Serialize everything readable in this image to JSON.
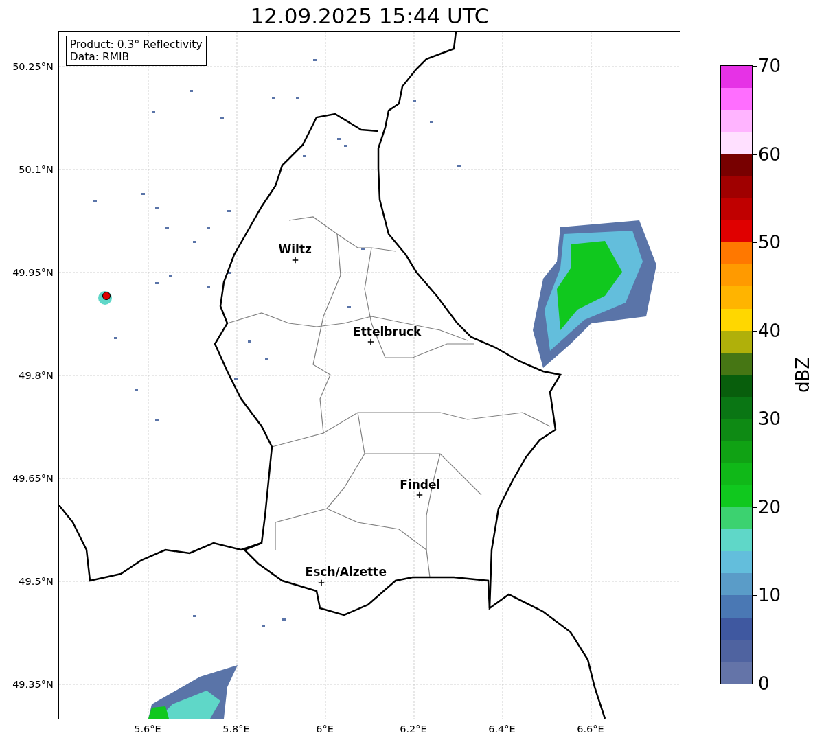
{
  "title": "12.09.2025 15:44 UTC",
  "legend": [
    "Product: 0.3° Reflectivity",
    "Data: RMIB"
  ],
  "map": {
    "lat_labels": [
      "50.25°N",
      "50.1°N",
      "49.95°N",
      "49.8°N",
      "49.65°N",
      "49.5°N",
      "49.35°N"
    ],
    "lon_labels": [
      "5.6°E",
      "5.8°E",
      "6°E",
      "6.2°E",
      "6.4°E",
      "6.6°E"
    ],
    "cities": [
      {
        "name": "Wiltz"
      },
      {
        "name": "Ettelbruck"
      },
      {
        "name": "Findel"
      },
      {
        "name": "Esch/Alzette"
      }
    ]
  },
  "colorbar": {
    "label": "dBZ",
    "ticks": [
      "70",
      "60",
      "50",
      "40",
      "30",
      "20",
      "10",
      "0"
    ],
    "segments": [
      {
        "color": "#e632e6"
      },
      {
        "color": "#ff6eff"
      },
      {
        "color": "#ffb4ff"
      },
      {
        "color": "#ffe0ff"
      },
      {
        "color": "#780000"
      },
      {
        "color": "#a00000"
      },
      {
        "color": "#c00000"
      },
      {
        "color": "#e00000"
      },
      {
        "color": "#ff7800"
      },
      {
        "color": "#ff9a00"
      },
      {
        "color": "#ffb400"
      },
      {
        "color": "#ffd700"
      },
      {
        "color": "#b0b00a"
      },
      {
        "color": "#467614"
      },
      {
        "color": "#085e0c"
      },
      {
        "color": "#0a7614"
      },
      {
        "color": "#0e8a14"
      },
      {
        "color": "#10a214"
      },
      {
        "color": "#10b818"
      },
      {
        "color": "#10c81e"
      },
      {
        "color": "#3cd270"
      },
      {
        "color": "#5fd7c8"
      },
      {
        "color": "#63bedc"
      },
      {
        "color": "#5a9cc8"
      },
      {
        "color": "#4a78b4"
      },
      {
        "color": "#3f58a0"
      },
      {
        "color": "#4f63a0"
      },
      {
        "color": "#6474a8"
      }
    ]
  }
}
